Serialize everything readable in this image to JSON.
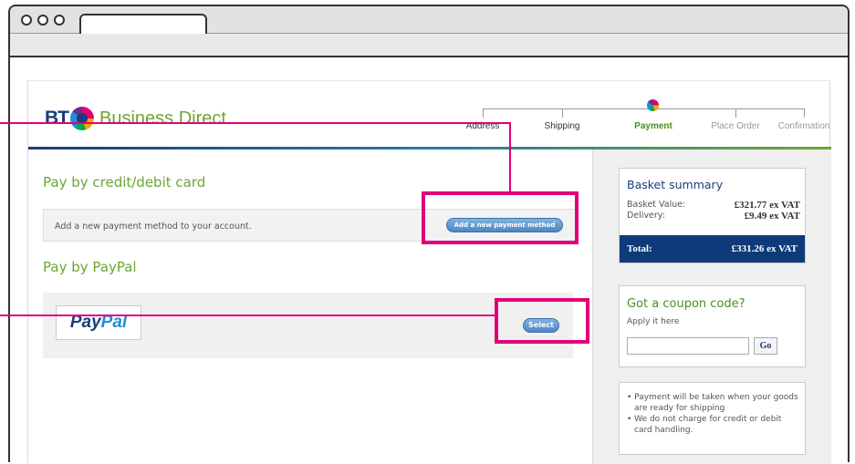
{
  "logo": {
    "brand": "BT",
    "name": "Business Direct"
  },
  "steps": [
    {
      "label": "Address",
      "state": "done"
    },
    {
      "label": "Shipping",
      "state": "done"
    },
    {
      "label": "Payment",
      "state": "active"
    },
    {
      "label": "Place Order",
      "state": "todo"
    },
    {
      "label": "Confirmation",
      "state": "todo"
    }
  ],
  "card": {
    "heading": "Pay by credit/debit card",
    "description": "Add a new payment method to your account.",
    "button_label": "Add a new payment method"
  },
  "paypal": {
    "heading": "Pay by PayPal",
    "logo_part1": "Pay",
    "logo_part2": "Pal",
    "button_label": "Select"
  },
  "basket": {
    "title": "Basket summary",
    "rows": [
      {
        "label": "Basket Value:",
        "value": "£321.77 ex VAT"
      },
      {
        "label": "Delivery:",
        "value": "£9.49 ex VAT"
      }
    ],
    "total_label": "Total:",
    "total_value": "£331.26 ex VAT"
  },
  "coupon": {
    "title": "Got a coupon code?",
    "subtitle": "Apply it here",
    "input_value": "",
    "go_label": "Go"
  },
  "notes": [
    "• Payment will be taken when your goods are ready for shipping",
    "• We do not charge for credit or debit card handling."
  ],
  "colors": {
    "brand_blue": "#1a3c7c",
    "brand_green": "#6aa732",
    "annotation_magenta": "#e2007a",
    "total_bar": "#0f3a79"
  }
}
